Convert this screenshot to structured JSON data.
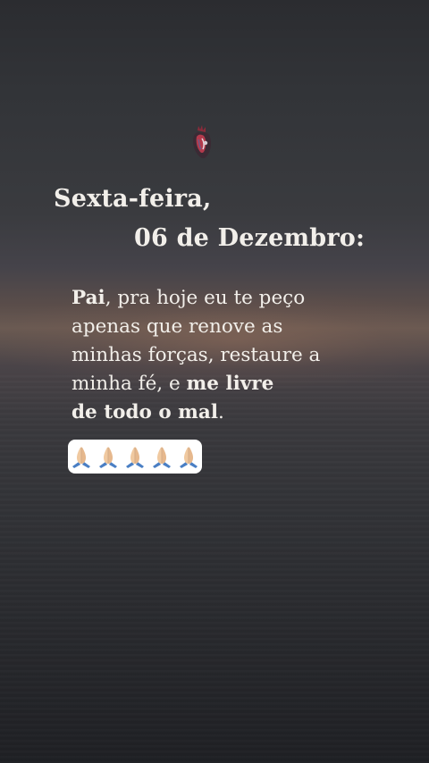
{
  "post": {
    "title_line_1": "Sexta-feira,",
    "title_line_2": "06 de Dezembro:",
    "message": {
      "l1_bold": "Pai",
      "l1_rest": ", pra hoje eu te peço",
      "l2": "apenas que renove as",
      "l3": "minhas forças, restaure a",
      "l4_rest": "minha fé, e ",
      "l4_bold": "me livre",
      "l5_bold": "de todo o mal",
      "l5_rest": "."
    },
    "sticker_icon": "anatomical-heart-icon",
    "emoji_icon": "praying-hands-icon",
    "emoji_count": 5
  },
  "colors": {
    "text": "#f2efea",
    "emoji_box_bg": "#ffffff",
    "sky_top": "#2b2c30",
    "horizon": "#6a5a52",
    "water_bottom": "#1f2024"
  }
}
